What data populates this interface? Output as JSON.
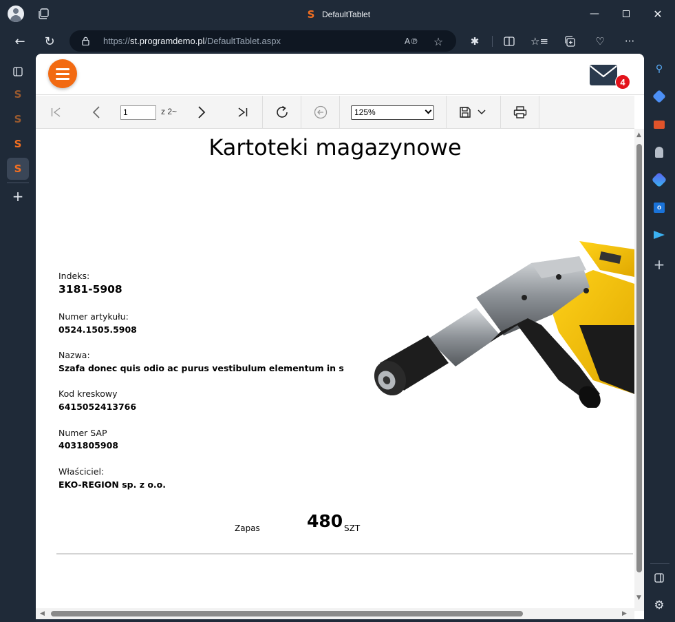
{
  "browser": {
    "window_title": "DefaultTablet",
    "url_host": "st.programdemo.pl",
    "url_path": "/DefaultTablet.aspx",
    "url_scheme": "https://",
    "accent_color": "#f36f21"
  },
  "header": {
    "mail_badge_count": "4",
    "brand_color": "#f26a12"
  },
  "toolbar": {
    "page_current": "1",
    "page_of": "z 2~",
    "zoom": "125%"
  },
  "report": {
    "title": "Kartoteki magazynowe",
    "fields": [
      {
        "label": "Indeks:",
        "value": "3181-5908"
      },
      {
        "label": "Numer artykułu:",
        "value": "0524.1505.5908"
      },
      {
        "label": "Nazwa:",
        "value": "Szafa donec quis odio ac purus vestibulum elementum in s"
      },
      {
        "label": "Kod kreskowy",
        "value": "6415052413766"
      },
      {
        "label": "Numer SAP",
        "value": "4031805908"
      },
      {
        "label": "Właściciel:",
        "value": "EKO-REGION sp. z o.o."
      }
    ],
    "stock": {
      "label": "Zapas",
      "value": "480",
      "unit": "SZT"
    }
  }
}
